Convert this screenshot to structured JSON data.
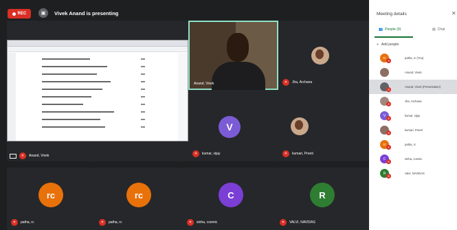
{
  "top_bar": {
    "rec_label": "REC",
    "presenter_label": "Vivek Anand is presenting"
  },
  "tiles": {
    "screen_share": {
      "name": "Anand, Vivek"
    },
    "presenter_video": {
      "name": "Anand, Vivek"
    },
    "jha_archana": {
      "name": "Jha, Archana"
    },
    "kumar_vijay": {
      "name": "kumar, vijay",
      "initial": "V",
      "color": "#7b5cd6"
    },
    "kumari_preeti": {
      "name": "kumari, Preeti"
    },
    "jatha_rc_1": {
      "name": "patha, rc",
      "initial": "rc",
      "color": "#e8710a"
    },
    "jatha_rc_2": {
      "name": "patha, rc",
      "initial": "rc",
      "color": "#e8710a"
    },
    "sinha_cosmic": {
      "name": "sinha, cosmic",
      "initial": "C",
      "color": "#7b3fd6"
    },
    "valvi_navidas": {
      "name": "VALVI, NAVIDAS",
      "initial": "R",
      "color": "#2e7d32"
    }
  },
  "panel": {
    "title": "Meeting details",
    "tab_people": "People (9)",
    "tab_chat": "Chat",
    "add_people": "Add people",
    "participants": [
      {
        "name": "patha, rc (You)",
        "initial": "rc",
        "color": "#e8710a"
      },
      {
        "name": "Anand, Vivek",
        "initial": "",
        "color": "#8d6e63"
      },
      {
        "name": "Anand, Vivek (Presentation)",
        "initial": "",
        "color": "#5f6368"
      },
      {
        "name": "Jha, Archana",
        "initial": "",
        "color": "#a1887f"
      },
      {
        "name": "kumar, vijay",
        "initial": "V",
        "color": "#7b5cd6"
      },
      {
        "name": "kumari, Preeti",
        "initial": "",
        "color": "#8d6e63"
      },
      {
        "name": "patha, rc",
        "initial": "rc",
        "color": "#e8710a"
      },
      {
        "name": "sinha, cosmic",
        "initial": "C",
        "color": "#7b3fd6"
      },
      {
        "name": "valvi, NAVIDAS",
        "initial": "R",
        "color": "#2e7d32"
      }
    ]
  }
}
